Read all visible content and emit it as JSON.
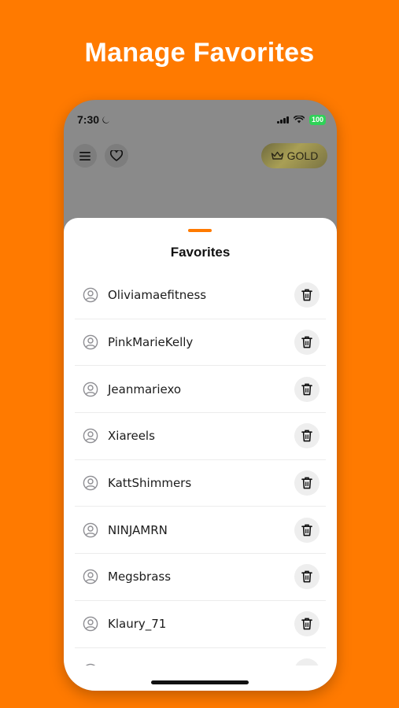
{
  "headline": "Manage Favorites",
  "status_bar": {
    "time": "7:30",
    "battery": "100"
  },
  "top_bar": {
    "gold_label": "GOLD"
  },
  "sheet": {
    "title": "Favorites",
    "favorites": [
      "Oliviamaefitness",
      "PinkMarieKelly",
      "Jeanmariexo",
      "Xiareels",
      "KattShimmers",
      "NINJAMRN",
      "Megsbrass",
      "Klaury_71"
    ]
  },
  "colors": {
    "background": "#FF7A00",
    "battery": "#30D158",
    "accent": "#FF7A00"
  }
}
